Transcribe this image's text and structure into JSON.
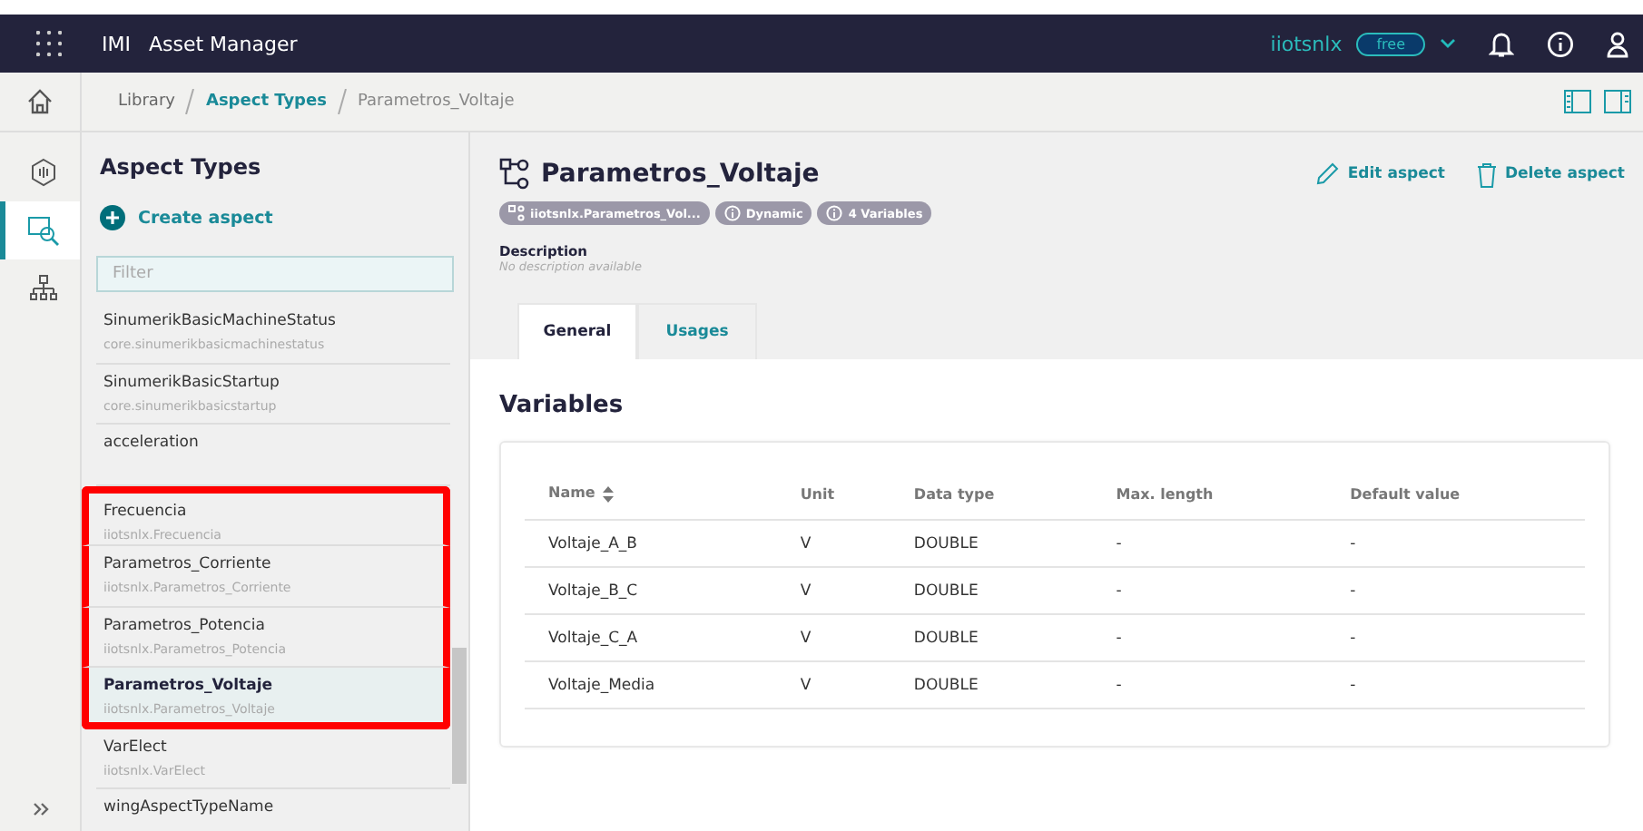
{
  "topbar": {
    "brand": "IMI",
    "app": "Asset Manager",
    "tenant": "iiotsnlx",
    "plan": "free"
  },
  "breadcrumb": [
    {
      "label": "Library",
      "kind": "link"
    },
    {
      "label": "Aspect Types",
      "kind": "active"
    },
    {
      "label": "Parametros_Voltaje",
      "kind": "current"
    }
  ],
  "rail": [
    {
      "kind": "hex",
      "selected": false
    },
    {
      "kind": "search",
      "selected": true
    },
    {
      "kind": "tree",
      "selected": false
    }
  ],
  "sidebar": {
    "title": "Aspect Types",
    "create": "Create aspect",
    "filter_placeholder": "Filter",
    "items": [
      {
        "name": "SinumerikBasicMachineStatus",
        "id": "core.sinumerikbasicmachinestatus",
        "selected": false,
        "highlighted": false
      },
      {
        "name": "SinumerikBasicStartup",
        "id": "core.sinumerikbasicstartup",
        "selected": false,
        "highlighted": false
      },
      {
        "name": "acceleration",
        "selected": false,
        "highlighted": false
      },
      {
        "name": "Frecuencia",
        "id": "iiotsnlx.Frecuencia",
        "selected": false,
        "highlighted": true
      },
      {
        "name": "Parametros_Corriente",
        "id": "iiotsnlx.Parametros_Corriente",
        "selected": false,
        "highlighted": true
      },
      {
        "name": "Parametros_Potencia",
        "id": "iiotsnlx.Parametros_Potencia",
        "selected": false,
        "highlighted": true
      },
      {
        "name": "Parametros_Voltaje",
        "id": "iiotsnlx.Parametros_Voltaje",
        "selected": true,
        "highlighted": true
      },
      {
        "name": "VarElect",
        "id": "iiotsnlx.VarElect",
        "selected": false,
        "highlighted": false
      },
      {
        "name": "wingAspectTypeName",
        "selected": false,
        "highlighted": false
      }
    ]
  },
  "detail": {
    "title": "Parametros_Voltaje",
    "edit": "Edit aspect",
    "delete": "Delete aspect",
    "badges": [
      {
        "label": "iiotsnlx.Parametros_Vol...",
        "kind": "type"
      },
      {
        "label": "Dynamic",
        "kind": "info"
      },
      {
        "label": "4 Variables",
        "kind": "info"
      }
    ],
    "description_label": "Description",
    "description": "No description available",
    "tabs": [
      {
        "label": "General",
        "selected": true
      },
      {
        "label": "Usages",
        "selected": false
      }
    ],
    "section": "Variables",
    "table": {
      "columns": [
        "Name",
        "Unit",
        "Data type",
        "Max. length",
        "Default value"
      ],
      "rows": [
        [
          "Voltaje_A_B",
          "V",
          "DOUBLE",
          "-",
          "-"
        ],
        [
          "Voltaje_B_C",
          "V",
          "DOUBLE",
          "-",
          "-"
        ],
        [
          "Voltaje_C_A",
          "V",
          "DOUBLE",
          "-",
          "-"
        ],
        [
          "Voltaje_Media",
          "V",
          "DOUBLE",
          "-",
          "-"
        ]
      ]
    }
  }
}
